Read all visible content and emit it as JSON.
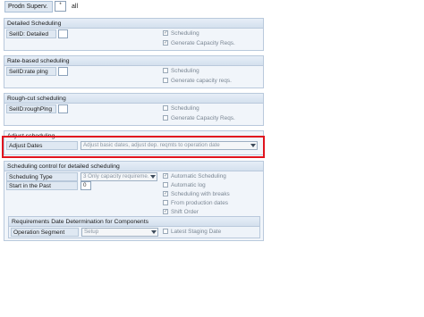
{
  "topbar": {
    "label": "Prodn Superv.",
    "box": "*",
    "value": "all"
  },
  "detailed": {
    "title": "Detailed Scheduling",
    "field_label": "SelID: Detailed",
    "checkboxes": [
      {
        "label": "Scheduling",
        "checked": true
      },
      {
        "label": "Generate Capacity Reqs.",
        "checked": true
      }
    ]
  },
  "rate": {
    "title": "Rate-based scheduling",
    "field_label": "SelID:rate plng",
    "checkboxes": [
      {
        "label": "Scheduling",
        "checked": false
      },
      {
        "label": "Generate capacity reqs.",
        "checked": false
      }
    ]
  },
  "rough": {
    "title": "Rough-cut scheduling",
    "field_label": "SelID:roughPlng",
    "checkboxes": [
      {
        "label": "Scheduling",
        "checked": false
      },
      {
        "label": "Generate Capacity Reqs.",
        "checked": false
      }
    ]
  },
  "adjust": {
    "title": "Adjust scheduling",
    "field_label": "Adjust Dates",
    "dropdown_value": "Adjust basic dates, adjust dep. reqmts to operation date"
  },
  "control": {
    "title": "Scheduling control for detailed scheduling",
    "type_label": "Scheduling Type",
    "type_value": "3 Only capacity requireme...",
    "past_label": "Start in the Past",
    "past_value": "0",
    "checkboxes": [
      {
        "label": "Automatic Scheduling",
        "checked": true
      },
      {
        "label": "Automatic log",
        "checked": false
      },
      {
        "label": "Scheduling with breaks",
        "checked": true
      },
      {
        "label": "From production dates",
        "checked": false
      },
      {
        "label": "Shift Order",
        "checked": true
      }
    ],
    "req": {
      "title": "Requirements Date Determination for Components",
      "segment_label": "Operation Segment",
      "segment_value": "Setup",
      "staging_label": "Latest Staging Date",
      "staging_checked": false
    }
  }
}
